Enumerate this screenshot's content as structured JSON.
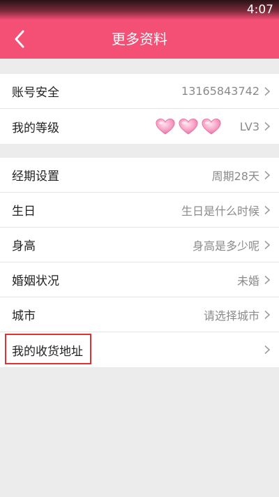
{
  "status_bar": {
    "time": "4:07"
  },
  "header": {
    "title": "更多资料",
    "back_icon": "chevron-left-icon"
  },
  "colors": {
    "accent": "#f44f74",
    "heart": "#f6a0c4"
  },
  "groups": [
    {
      "rows": [
        {
          "label": "账号安全",
          "value": "13165843742"
        },
        {
          "label": "我的等级",
          "value": "LV3",
          "hearts": 3
        }
      ]
    },
    {
      "rows": [
        {
          "label": "经期设置",
          "value": "周期28天"
        },
        {
          "label": "生日",
          "value": "生日是什么时候"
        },
        {
          "label": "身高",
          "value": "身高是多少呢"
        },
        {
          "label": "婚姻状况",
          "value": "未婚"
        },
        {
          "label": "城市",
          "value": "请选择城市"
        },
        {
          "label": "我的收货地址",
          "value": ""
        }
      ]
    }
  ]
}
